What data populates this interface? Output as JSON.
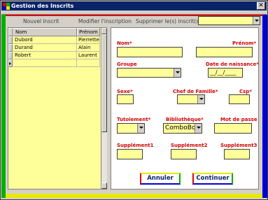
{
  "window": {
    "title": "Gestion des Inscrits",
    "close_glyph": "✕"
  },
  "toolbar": {
    "new_label": "Nouvel Inscrit",
    "edit_label": "Modifier l'inscription",
    "delete_label": "Supprimer le(s) inscrit(s)",
    "filter_value": ""
  },
  "grid": {
    "columns": [
      "Nom",
      "Prénom"
    ],
    "rows": [
      [
        "Dubord",
        "Pierrette"
      ],
      [
        "Durand",
        "Alain"
      ],
      [
        "Robert",
        "Laurent"
      ]
    ]
  },
  "form": {
    "nom_label": "Nom*",
    "prenom_label": "Prénom*",
    "groupe_label": "Groupe",
    "naissance_label": "Date de naissance*",
    "naissance_mask": "__/__/____",
    "sexe_label": "Sexe*",
    "chef_label": "Chef de Famille*",
    "csp_label": "Csp*",
    "tutoiement_label": "Tutoiement*",
    "bibliotheque_label": "Bibliothèque*",
    "bibliotheque_value": "ComboBo",
    "motdepasse_label": "Mot de passe",
    "supp1_label": "Supplément1",
    "supp2_label": "Supplément2",
    "supp3_label": "Supplément3",
    "cancel_label": "Annuler",
    "continue_label": "Continuer"
  },
  "colors": {
    "title_bar": "#0a246a",
    "field_bg": "#ffff99",
    "label_red": "#d40000",
    "strip_green": "#00b000",
    "strip_blue": "#0000d0",
    "strip_red": "#e00000",
    "strip_yellow": "#e8e800"
  }
}
